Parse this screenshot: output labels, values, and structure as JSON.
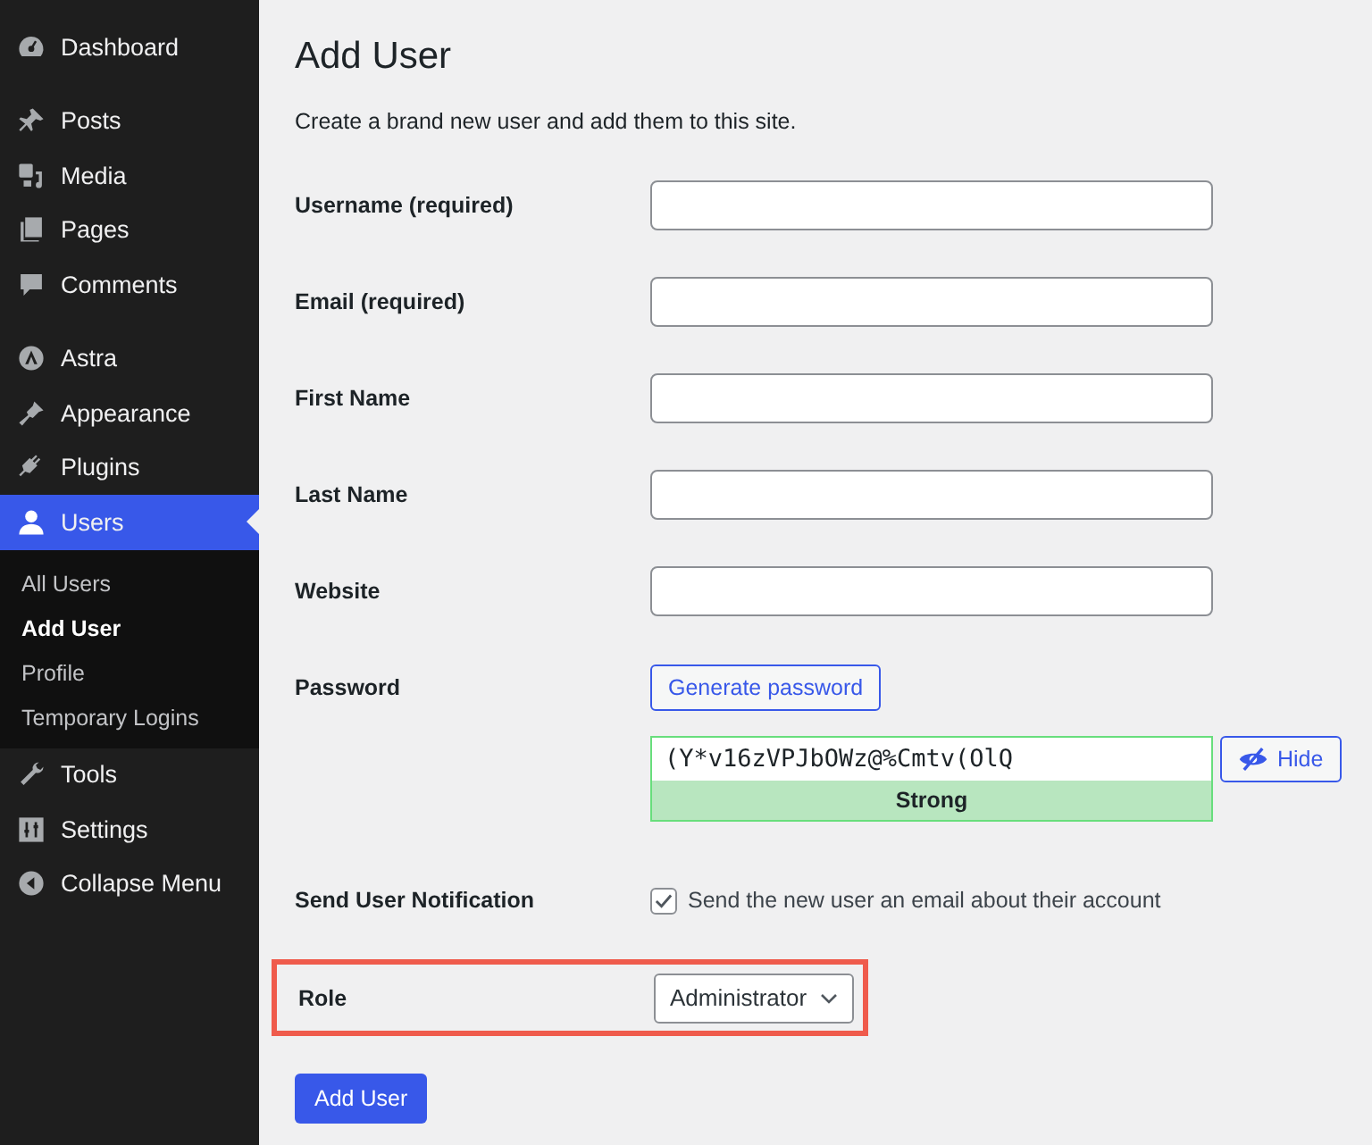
{
  "sidebar": {
    "groups": [
      [
        {
          "label": "Dashboard",
          "selected": false
        }
      ],
      [
        {
          "label": "Posts",
          "selected": false
        },
        {
          "label": "Media",
          "selected": false
        },
        {
          "label": "Pages",
          "selected": false
        },
        {
          "label": "Comments",
          "selected": false
        }
      ],
      [
        {
          "label": "Astra",
          "selected": false
        },
        {
          "label": "Appearance",
          "selected": false
        },
        {
          "label": "Plugins",
          "selected": false
        },
        {
          "label": "Users",
          "selected": true,
          "children": [
            {
              "label": "All Users",
              "selected": false
            },
            {
              "label": "Add User",
              "selected": true
            },
            {
              "label": "Profile",
              "selected": false
            },
            {
              "label": "Temporary Logins",
              "selected": false
            }
          ]
        },
        {
          "label": "Tools",
          "selected": false
        },
        {
          "label": "Settings",
          "selected": false
        },
        {
          "label": "Collapse Menu",
          "selected": false
        }
      ]
    ]
  },
  "page": {
    "title": "Add User",
    "description": "Create a brand new user and add them to this site."
  },
  "fields": [
    {
      "label": "Username (required)"
    },
    {
      "label": "Email (required)"
    },
    {
      "label": "First Name"
    },
    {
      "label": "Last Name"
    },
    {
      "label": "Website"
    }
  ],
  "password": {
    "label": "Password",
    "generate_button": "Generate password",
    "value": "(Y*v16zVPJbOWz@%Cmtv(OlQ",
    "strength": "Strong",
    "hide_button": "Hide"
  },
  "notification": {
    "label": "Send User Notification",
    "checkbox_label": "Send the new user an email about their account",
    "checked": true
  },
  "role": {
    "label": "Role",
    "value": "Administrator",
    "highlighted": true
  },
  "submit": "Add User"
}
